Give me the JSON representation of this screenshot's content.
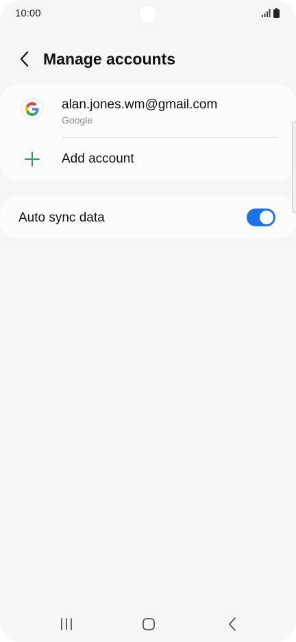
{
  "status_bar": {
    "time": "10:00",
    "icons": [
      "signal-icon",
      "battery-icon"
    ]
  },
  "header": {
    "back_icon": "chevron-left-icon",
    "title": "Manage accounts"
  },
  "accounts": {
    "items": [
      {
        "icon": "google-logo-icon",
        "email": "alan.jones.wm@gmail.com",
        "provider": "Google"
      }
    ],
    "add_icon": "plus-icon",
    "add_label": "Add account"
  },
  "sync": {
    "label": "Auto sync data",
    "enabled": true
  },
  "nav_bar": {
    "icons": [
      "recent-apps-icon",
      "home-icon",
      "back-icon"
    ]
  },
  "colors": {
    "background": "#f5f5f5",
    "card": "#fcfcfc",
    "accent": "#1a73e8",
    "plus_green": "#2e9e5b",
    "secondary_text": "#8a8a8a"
  }
}
